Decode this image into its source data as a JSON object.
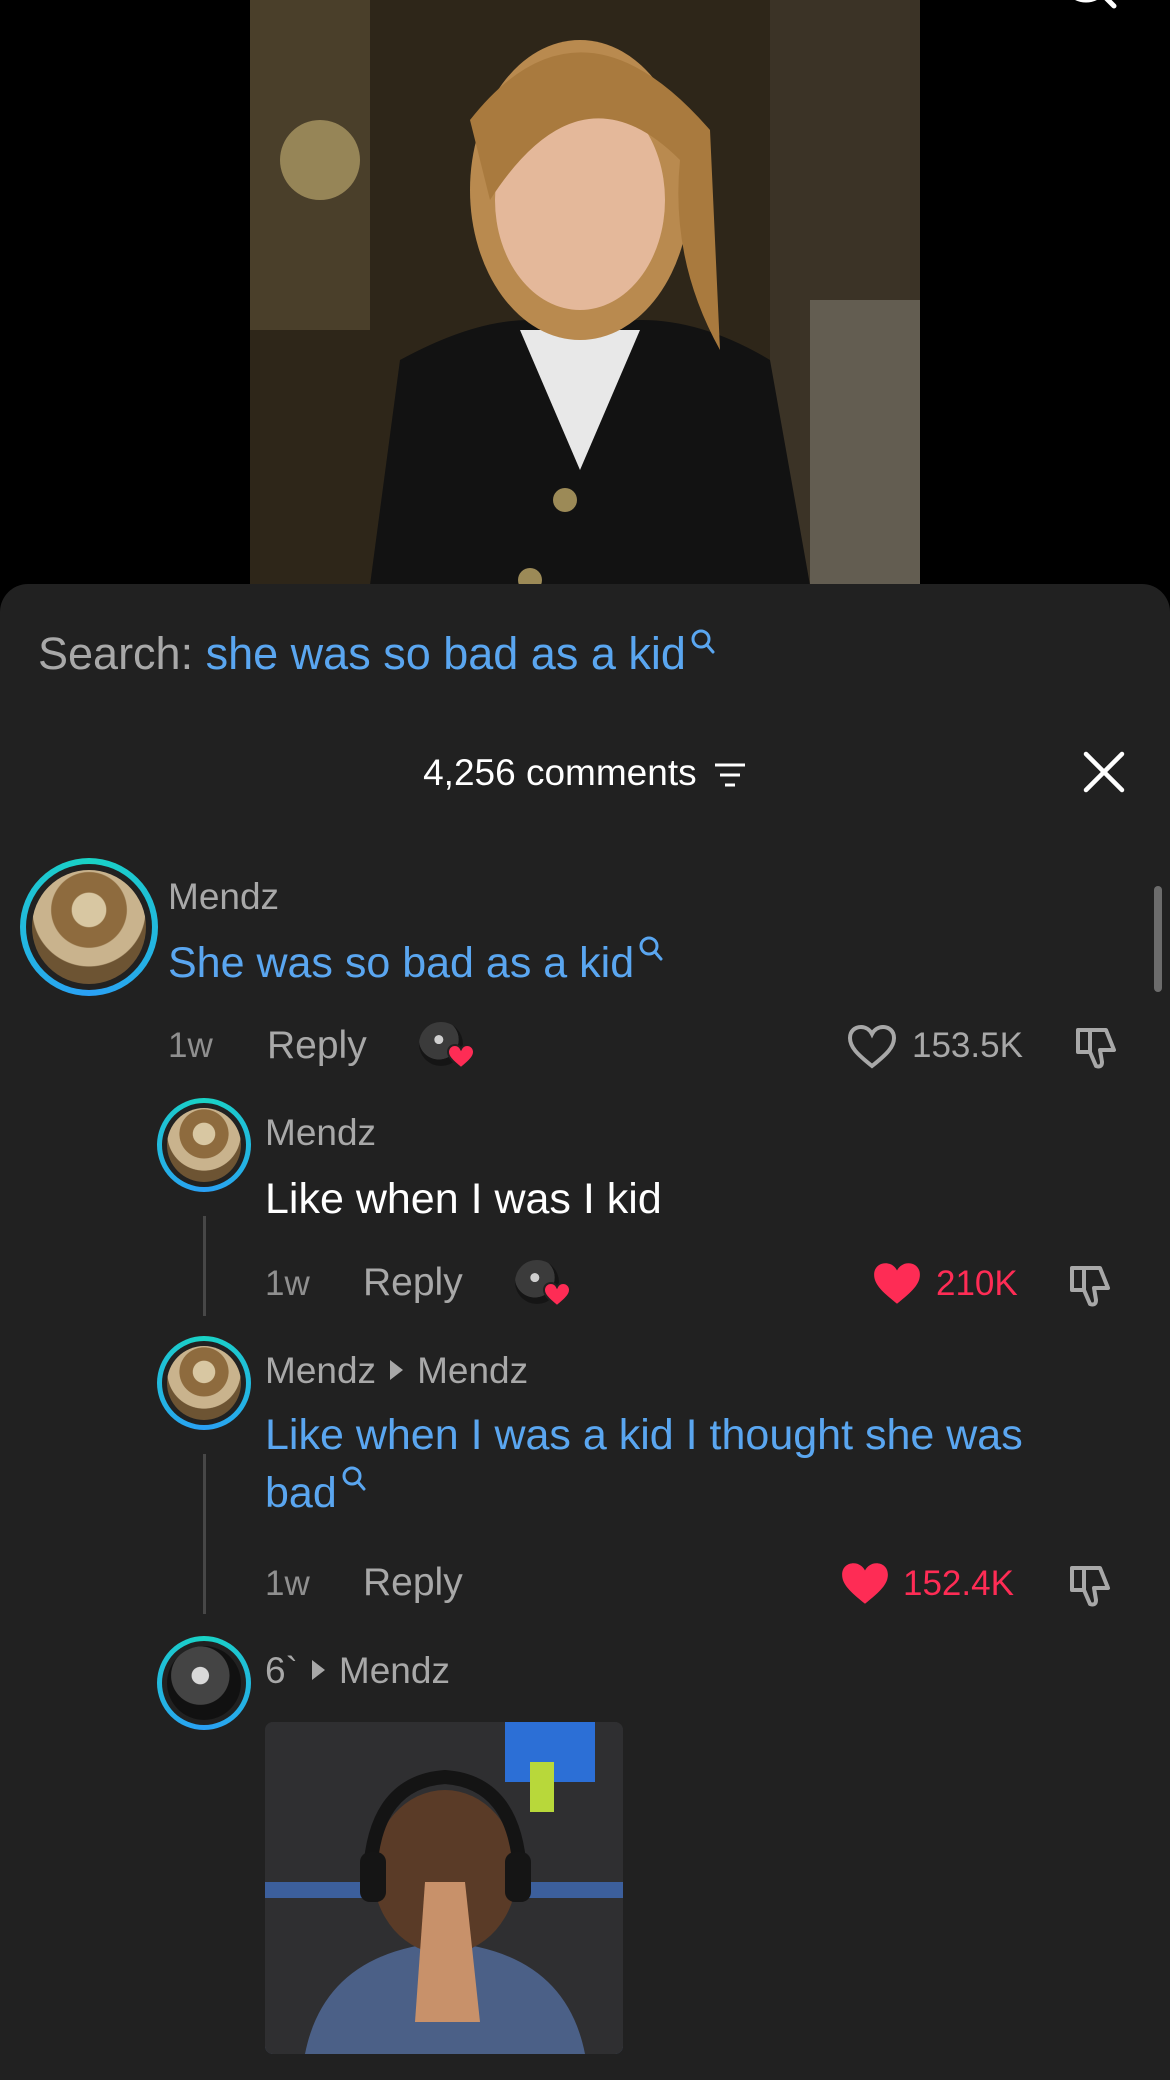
{
  "search": {
    "label": "Search:",
    "query": "she was so bad as a kid"
  },
  "header": {
    "comment_count": "4,256 comments"
  },
  "comments": [
    {
      "username": "Mendz",
      "text": "She was so bad as a kid",
      "time": "1w",
      "reply_label": "Reply",
      "likes": "153.5K",
      "liked": false
    },
    {
      "username": "Mendz",
      "text": "Like when I was I kid",
      "time": "1w",
      "reply_label": "Reply",
      "likes": "210K",
      "liked": true
    },
    {
      "username": "Mendz",
      "reply_to": "Mendz",
      "text_line1": "Like when I was a kid I thought she was",
      "text_line2": "bad",
      "time": "1w",
      "reply_label": "Reply",
      "likes": "152.4K",
      "liked": true
    },
    {
      "username": "6`",
      "reply_to": "Mendz"
    }
  ],
  "colors": {
    "accent_blue": "#5aa6f0",
    "like_red": "#fe2c55",
    "sheet_bg": "#212121"
  }
}
